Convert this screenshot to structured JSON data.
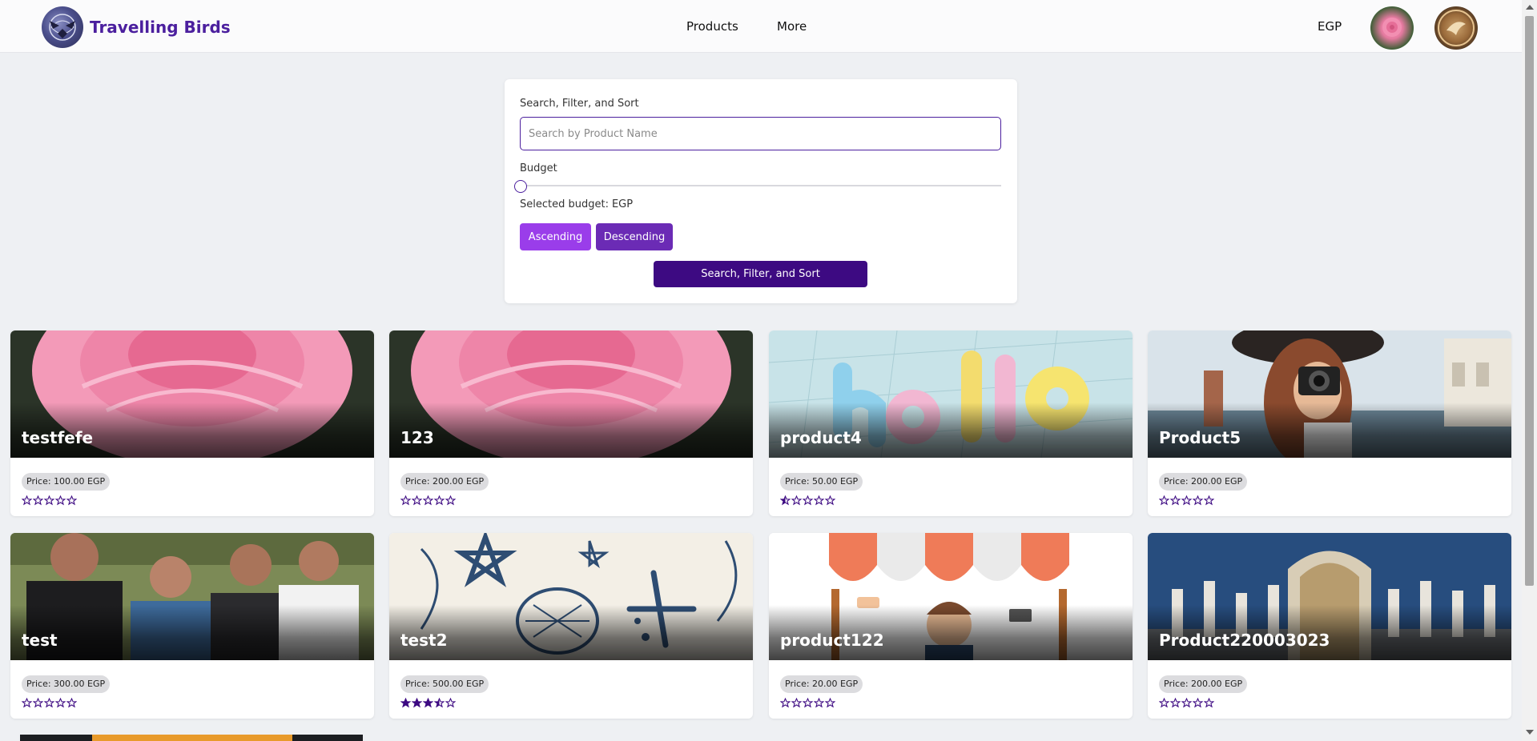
{
  "header": {
    "brand": "Travelling Birds",
    "nav": [
      "Products",
      "More"
    ],
    "currency": "EGP"
  },
  "search_panel": {
    "title": "Search, Filter, and Sort",
    "search_placeholder": "Search by Product Name",
    "budget_label": "Budget",
    "budget_text": "Selected budget:",
    "budget_currency": "EGP",
    "ascending_label": "Ascending",
    "descending_label": "Descending",
    "submit_label": "Search, Filter, and Sort"
  },
  "products": [
    {
      "name": "testfefe",
      "price": "Price: 100.00 EGP",
      "rating": 0,
      "image": "pink-rose-icon"
    },
    {
      "name": "123",
      "price": "Price: 200.00 EGP",
      "rating": 0,
      "image": "pink-rose-icon"
    },
    {
      "name": "product4",
      "price": "Price: 50.00 EGP",
      "rating": 0.5,
      "image": "hello-letters-icon"
    },
    {
      "name": "Product5",
      "price": "Price: 200.00 EGP",
      "rating": 0,
      "image": "photographer-icon"
    },
    {
      "name": "test",
      "price": "Price: 300.00 EGP",
      "rating": 0,
      "image": "group-photo-icon"
    },
    {
      "name": "test2",
      "price": "Price: 500.00 EGP",
      "rating": 3.5,
      "image": "seashells-icon"
    },
    {
      "name": "product122",
      "price": "Price: 20.00 EGP",
      "rating": 0,
      "image": "shop-awning-icon"
    },
    {
      "name": "Product220003023",
      "price": "Price: 200.00 EGP",
      "rating": 0,
      "image": "museum-hall-icon"
    }
  ],
  "colors": {
    "brand": "#4b1f9e",
    "accent_light": "#9a3dea",
    "accent_mid": "#6b2bb5",
    "accent_dark": "#3d0a82",
    "background": "#eef0f3",
    "star": "#3d0a82"
  }
}
